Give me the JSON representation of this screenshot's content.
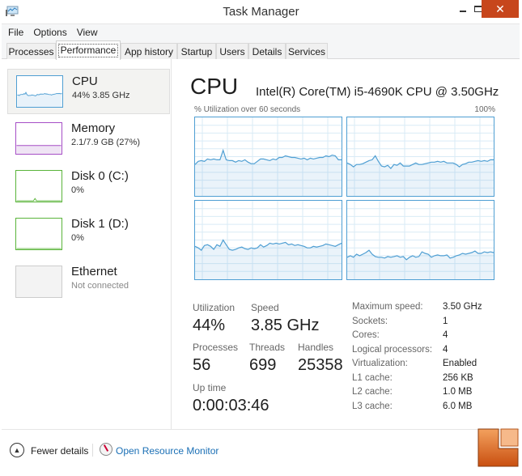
{
  "window": {
    "title": "Task Manager",
    "app_icon": "task-manager-icon",
    "controls": {
      "minimize": "minimize-icon",
      "maximize": "maximize-icon",
      "close": "close-icon",
      "close_glyph": "✕"
    },
    "close_color": "#c7461c"
  },
  "menu": [
    "File",
    "Options",
    "View"
  ],
  "tabs": [
    {
      "label": "Processes",
      "active": false
    },
    {
      "label": "Performance",
      "active": true
    },
    {
      "label": "App history",
      "active": false
    },
    {
      "label": "Startup",
      "active": false
    },
    {
      "label": "Users",
      "active": false
    },
    {
      "label": "Details",
      "active": false
    },
    {
      "label": "Services",
      "active": false
    }
  ],
  "sidebar": {
    "items": [
      {
        "name": "CPU",
        "sub": "44%  3.85 GHz",
        "color": "#4f9fd3",
        "selected": true
      },
      {
        "name": "Memory",
        "sub": "2.1/7.9 GB (27%)",
        "color": "#a64ec6",
        "selected": false
      },
      {
        "name": "Disk 0 (C:)",
        "sub": "0%",
        "color": "#5ab43a",
        "selected": false
      },
      {
        "name": "Disk 1 (D:)",
        "sub": "0%",
        "color": "#5ab43a",
        "selected": false
      },
      {
        "name": "Ethernet",
        "sub": "Not connected",
        "color": "#cccccc",
        "selected": false
      }
    ],
    "memory_usage_percent": 27
  },
  "main": {
    "title": "CPU",
    "model": "Intel(R) Core(TM) i5-4690K CPU @ 3.50GHz",
    "graph_label": "% Utilization over 60 seconds",
    "graph_max": "100%",
    "graph_color": "#4f9fd3",
    "cores": [
      {
        "name": "core-0",
        "values": [
          40,
          44,
          45,
          44,
          47,
          46,
          47,
          46,
          46,
          58,
          46,
          45,
          45,
          43,
          45,
          44,
          46,
          43,
          41,
          41,
          44,
          47,
          47,
          46,
          45,
          47,
          46,
          49,
          49,
          51,
          50,
          49,
          49,
          48,
          47,
          48,
          46,
          48,
          47,
          48,
          49,
          49,
          51,
          50,
          52,
          51,
          46,
          46
        ]
      },
      {
        "name": "core-1",
        "values": [
          42,
          40,
          37,
          40,
          40,
          41,
          43,
          45,
          46,
          51,
          44,
          38,
          37,
          39,
          35,
          40,
          39,
          42,
          38,
          38,
          38,
          40,
          42,
          40,
          40,
          41,
          42,
          43,
          43,
          44,
          43,
          44,
          42,
          42,
          42,
          40,
          37,
          40,
          41,
          43,
          43,
          44,
          45,
          44,
          45,
          44,
          46,
          46
        ]
      },
      {
        "name": "core-2",
        "values": [
          42,
          40,
          37,
          43,
          44,
          42,
          38,
          44,
          42,
          50,
          44,
          38,
          37,
          38,
          40,
          41,
          39,
          38,
          40,
          39,
          40,
          44,
          41,
          43,
          46,
          45,
          46,
          45,
          46,
          47,
          44,
          45,
          43,
          44,
          43,
          42,
          40,
          40,
          42,
          41,
          42,
          43,
          45,
          44,
          43,
          42,
          44,
          46
        ]
      },
      {
        "name": "core-3",
        "values": [
          28,
          30,
          28,
          32,
          30,
          32,
          34,
          37,
          32,
          29,
          28,
          28,
          27,
          29,
          28,
          29,
          30,
          28,
          29,
          25,
          28,
          30,
          28,
          29,
          35,
          33,
          32,
          28,
          30,
          31,
          30,
          30,
          31,
          27,
          28,
          30,
          31,
          33,
          32,
          33,
          34,
          36,
          33,
          33,
          35,
          34,
          35,
          34
        ]
      }
    ]
  },
  "stats": {
    "utilization": {
      "label": "Utilization",
      "value": "44%"
    },
    "speed": {
      "label": "Speed",
      "value": "3.85 GHz"
    },
    "processes": {
      "label": "Processes",
      "value": "56"
    },
    "threads": {
      "label": "Threads",
      "value": "699"
    },
    "handles": {
      "label": "Handles",
      "value": "25358"
    },
    "uptime": {
      "label": "Up time",
      "value": "0:00:03:46"
    }
  },
  "info": [
    {
      "label": "Maximum speed:",
      "value": "3.50 GHz"
    },
    {
      "label": "Sockets:",
      "value": "1"
    },
    {
      "label": "Cores:",
      "value": "4"
    },
    {
      "label": "Logical processors:",
      "value": "4"
    },
    {
      "label": "Virtualization:",
      "value": "Enabled"
    },
    {
      "label": "L1 cache:",
      "value": "256 KB"
    },
    {
      "label": "L2 cache:",
      "value": "1.0 MB"
    },
    {
      "label": "L3 cache:",
      "value": "6.0 MB"
    }
  ],
  "footer": {
    "fewer_details": "Fewer details",
    "open_resource_monitor": "Open Resource Monitor",
    "link_color": "#1a6fb5"
  },
  "watermark": "legit-reviews-logo"
}
